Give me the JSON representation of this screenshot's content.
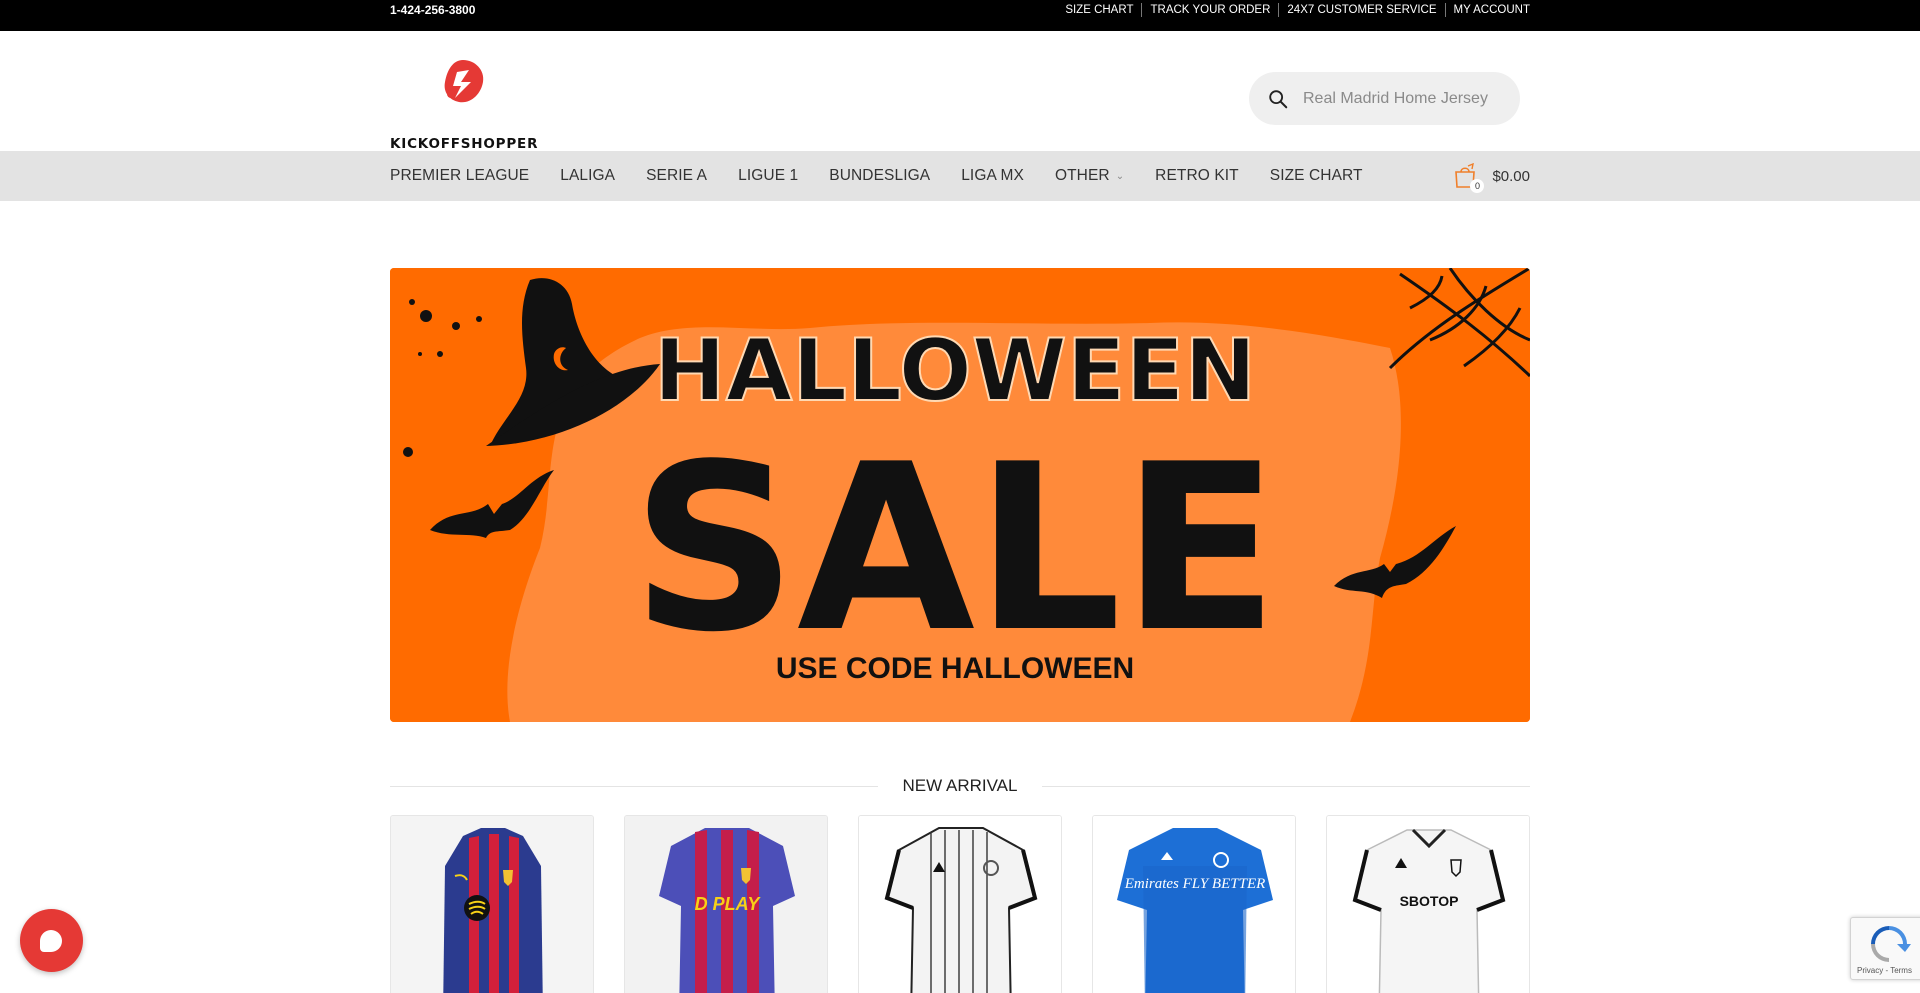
{
  "topbar": {
    "phone": "1-424-256-3800",
    "links": [
      "SIZE CHART",
      "TRACK YOUR ORDER",
      "24X7 CUSTOMER SERVICE",
      "MY ACCOUNT"
    ]
  },
  "header": {
    "logo_text": "KICKOFFSHOPPER",
    "search_placeholder": "Real Madrid Home Jersey"
  },
  "nav": {
    "items": [
      "PREMIER LEAGUE",
      "LALIGA",
      "SERIE A",
      "LIGUE 1",
      "BUNDESLIGA",
      "LIGA MX",
      "OTHER",
      "RETRO KIT",
      "SIZE CHART"
    ],
    "cart_count": "0",
    "cart_total": "$0.00"
  },
  "banner": {
    "line1": "HALLOWEEN",
    "line2": "SALE",
    "line3": "USE CODE HALLOWEEN"
  },
  "section": {
    "title": "NEW ARRIVAL"
  },
  "products": [
    {
      "sponsor": ""
    },
    {
      "sponsor": "D PLAY"
    },
    {
      "sponsor": ""
    },
    {
      "sponsor": "Emirates FLY BETTER"
    },
    {
      "sponsor": "SBOTOP"
    }
  ],
  "recaptcha": {
    "terms": "Privacy - Terms"
  },
  "colors": {
    "brand_red": "#e53935",
    "banner_orange": "#ff6b00",
    "banner_light": "#ff8a3a"
  }
}
